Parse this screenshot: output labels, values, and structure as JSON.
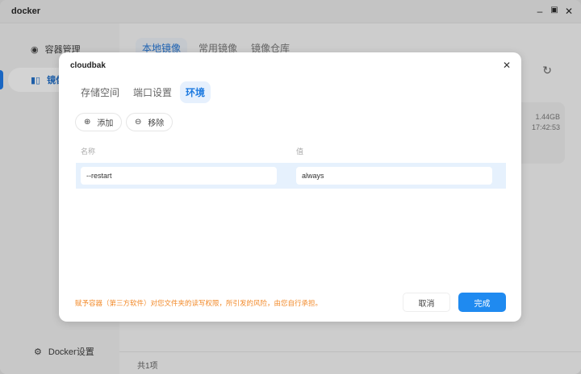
{
  "window": {
    "title": "docker",
    "min": "–",
    "max": "▣",
    "close": "✕"
  },
  "sidebar": {
    "items": [
      {
        "label": "容器管理"
      },
      {
        "label": "镜像"
      }
    ],
    "settings": "Docker设置"
  },
  "main": {
    "tabs": [
      "本地镜像",
      "常用镜像",
      "镜像仓库"
    ],
    "card": {
      "size": "1.44GB",
      "time": "17:42:53"
    },
    "footer": "共1项"
  },
  "modal": {
    "title": "cloudbak",
    "tabs": [
      "存储空间",
      "端口设置",
      "环境"
    ],
    "add": "添加",
    "remove": "移除",
    "columns": [
      "名称",
      "值"
    ],
    "rows": [
      {
        "name": "--restart",
        "value": "always"
      }
    ],
    "warning": "赋予容器（第三方软件）对您文件夹的读写权限，所引发的风险，由您自行承担。",
    "cancel": "取消",
    "ok": "完成"
  },
  "colors": {
    "accent": "#1f8af0",
    "warning": "#f28a2a"
  }
}
